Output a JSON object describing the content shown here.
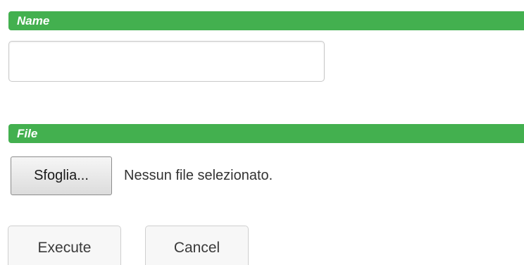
{
  "sections": {
    "name": {
      "label": "Name"
    },
    "file": {
      "label": "File"
    }
  },
  "name_input": {
    "value": "",
    "placeholder": ""
  },
  "file_picker": {
    "button_label": "Sfoglia...",
    "status_text": "Nessun file selezionato."
  },
  "actions": {
    "execute_label": "Execute",
    "cancel_label": "Cancel"
  },
  "colors": {
    "section_bar": "#43b04f",
    "section_text": "#ffffff"
  }
}
